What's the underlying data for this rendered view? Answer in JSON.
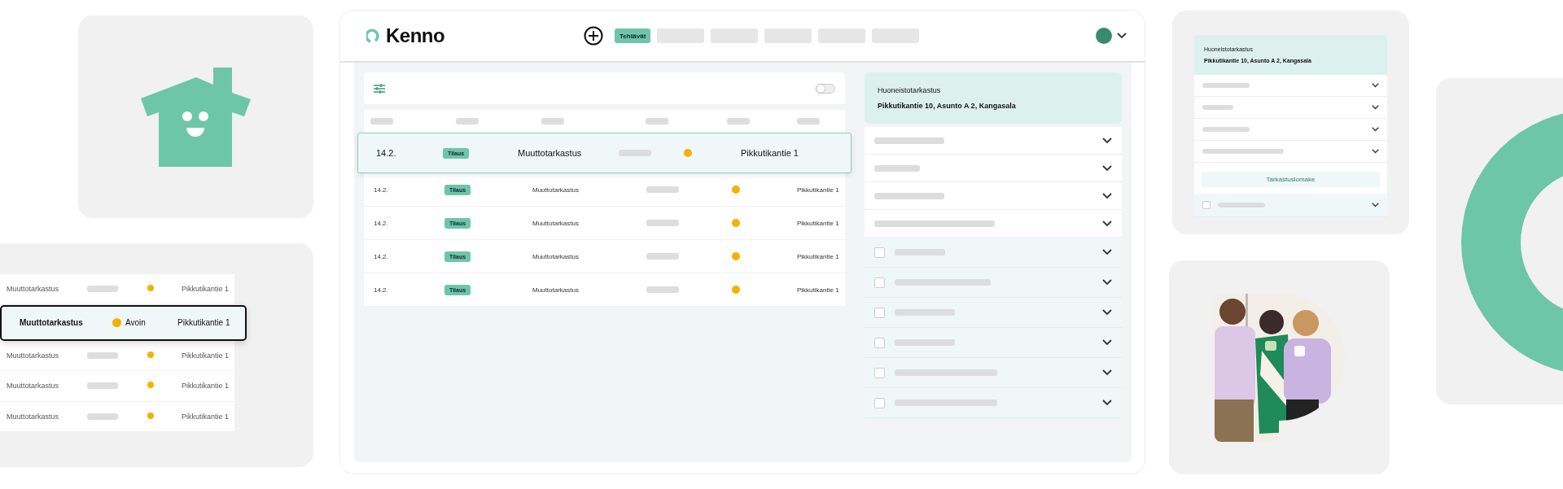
{
  "mini_table": {
    "rows": [
      {
        "task": "Muuttotarkastus",
        "address": "Pikkutikantie 1",
        "selected": false
      },
      {
        "task": "Muuttotarkastus",
        "status": "Avoin",
        "address": "Pikkutikantie 1",
        "selected": true
      },
      {
        "task": "Muuttotarkastus",
        "address": "Pikkutikantie 1",
        "selected": false
      },
      {
        "task": "Muuttotarkastus",
        "address": "Pikkutikantie 1",
        "selected": false
      },
      {
        "task": "Muuttotarkastus",
        "address": "Pikkutikantie 1",
        "selected": false
      }
    ]
  },
  "app": {
    "logo": "Kenno",
    "tabs": [
      {
        "label": "Tehtävät",
        "selected": true
      },
      {
        "selected": false
      },
      {
        "selected": false
      },
      {
        "selected": false
      },
      {
        "selected": false
      },
      {
        "selected": false
      }
    ],
    "filter_bar": {
      "toggle_on": false
    },
    "table": {
      "rows": [
        {
          "date": "14.2.",
          "type": "Tilaus",
          "task": "Muuttotarkastus",
          "address": "Pikkutikantie 1",
          "selected": true
        },
        {
          "date": "14.2.",
          "type": "Tilaus",
          "task": "Muuttotarkastus",
          "address": "Pikkutikantie 1",
          "selected": false
        },
        {
          "date": "14.2.",
          "type": "Tilaus",
          "task": "Muuttotarkastus",
          "address": "Pikkutikantie 1",
          "selected": false
        },
        {
          "date": "14.2.",
          "type": "Tilaus",
          "task": "Muuttotarkastus",
          "address": "Pikkutikantie 1",
          "selected": false
        },
        {
          "date": "14.2.",
          "type": "Tilaus",
          "task": "Muuttotarkastus",
          "address": "Pikkutikantie 1",
          "selected": false
        }
      ]
    },
    "detail": {
      "title": "Huoneistotarkastus",
      "address": "Pikkutikantie 10, Asunto A 2, Kangasala",
      "sections": [
        {
          "kind": "accordion"
        },
        {
          "kind": "accordion"
        },
        {
          "kind": "accordion"
        },
        {
          "kind": "accordion"
        },
        {
          "kind": "checklist",
          "checked": false
        },
        {
          "kind": "checklist",
          "checked": false
        },
        {
          "kind": "checklist",
          "checked": false
        },
        {
          "kind": "checklist",
          "checked": false
        },
        {
          "kind": "checklist",
          "checked": false
        },
        {
          "kind": "checklist",
          "checked": false
        }
      ]
    }
  },
  "mobile_card": {
    "title": "Huoneistotarkastus",
    "address": "Pikkutikantie 10, Asunto A 2, Kangasala",
    "sections": [
      {
        "kind": "accordion"
      },
      {
        "kind": "accordion"
      },
      {
        "kind": "accordion"
      },
      {
        "kind": "accordion"
      },
      {
        "kind": "button",
        "label": "Tarkastuslomake"
      },
      {
        "kind": "checklist",
        "checked": false
      }
    ]
  }
}
